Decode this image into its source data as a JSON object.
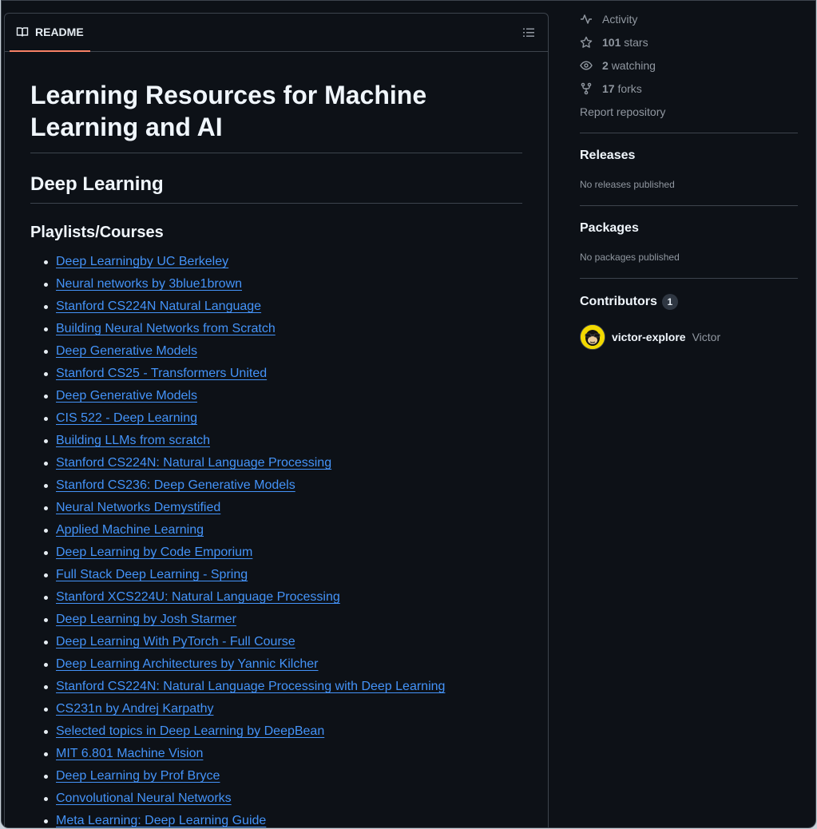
{
  "readme": {
    "tab_label": "README",
    "title": "Learning Resources for Machine Learning and AI",
    "section": "Deep Learning",
    "subsection": "Playlists/Courses",
    "links": [
      "Deep Learningby UC Berkeley",
      "Neural networks by 3blue1brown",
      "Stanford CS224N Natural Language",
      "Building Neural Networks from Scratch",
      "Deep Generative Models",
      "Stanford CS25 - Transformers United",
      "Deep Generative Models",
      "CIS 522 - Deep Learning",
      "Building LLMs from scratch",
      "Stanford CS224N: Natural Language Processing",
      "Stanford CS236: Deep Generative Models",
      "Neural Networks Demystified",
      "Applied Machine Learning",
      "Deep Learning by Code Emporium",
      "Full Stack Deep Learning - Spring",
      "Stanford XCS224U: Natural Language Processing",
      "Deep Learning by Josh Starmer",
      "Deep Learning With PyTorch - Full Course",
      "Deep Learning Architectures by Yannic Kilcher",
      "Stanford CS224N: Natural Language Processing with Deep Learning",
      "CS231n by Andrej Karpathy",
      "Selected topics in Deep Learning by DeepBean",
      "MIT 6.801 Machine Vision",
      "Deep Learning by Prof Bryce",
      "Convolutional Neural Networks",
      "Meta Learning: Deep Learning Guide"
    ]
  },
  "sidebar": {
    "activity_label": "Activity",
    "stars_count": "101",
    "stars_label": "stars",
    "watching_count": "2",
    "watching_label": "watching",
    "forks_count": "17",
    "forks_label": "forks",
    "report_label": "Report repository",
    "releases_heading": "Releases",
    "releases_note": "No releases published",
    "packages_heading": "Packages",
    "packages_note": "No packages published",
    "contributors_heading": "Contributors",
    "contributors_count": "1",
    "contributor_login": "victor-explore",
    "contributor_name": "Victor"
  },
  "colors": {
    "background": "#0d1117",
    "link": "#4493f8",
    "tab_underline": "#f78166",
    "muted": "#9198a1",
    "avatar_bg": "#f2d900"
  }
}
